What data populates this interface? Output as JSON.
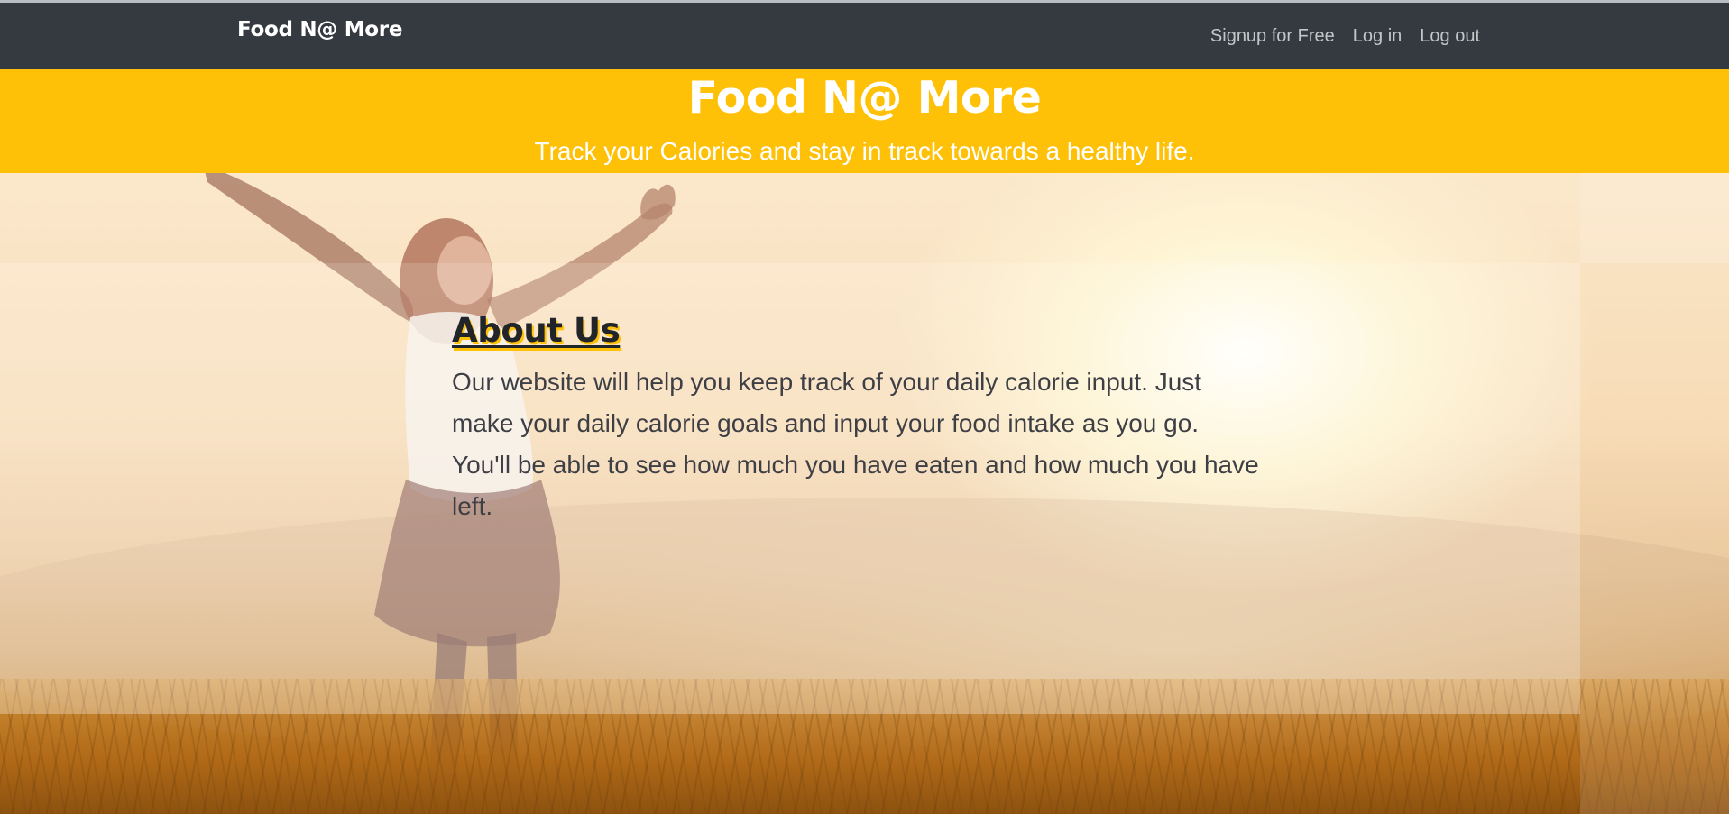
{
  "navbar": {
    "brand": "Food N@ More",
    "links": [
      {
        "label": "Signup for Free"
      },
      {
        "label": "Log in"
      },
      {
        "label": "Log out"
      }
    ]
  },
  "hero": {
    "title": "Food N@ More",
    "subtitle": "Track your Calories and stay in track towards a healthy life."
  },
  "about": {
    "heading": "About Us",
    "body": "Our website will help you keep track of your daily calorie input. Just make your daily calorie goals and input your food intake as you go. You'll be able to see how much you have eaten and how much you have left."
  },
  "colors": {
    "navbar_bg": "#343a40",
    "accent_yellow": "#ffc107",
    "nav_link": "#c4c6c8",
    "heading_text": "#212529"
  }
}
